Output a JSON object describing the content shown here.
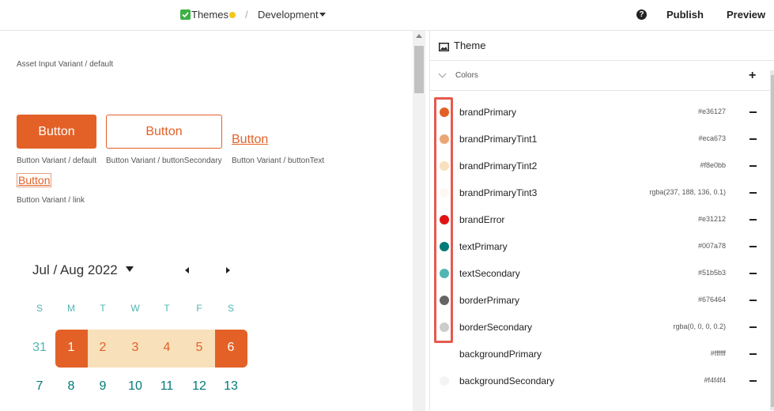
{
  "topbar": {
    "themes_label": "Themes",
    "separator": "/",
    "branch_label": "Development",
    "help_glyph": "?",
    "publish_label": "Publish",
    "preview_label": "Preview"
  },
  "canvas": {
    "asset_input_caption": "Asset Input Variant / default",
    "buttons": {
      "primary_label": "Button",
      "primary_caption": "Button Variant / default",
      "secondary_label": "Button",
      "secondary_caption": "Button Variant / buttonSecondary",
      "text_label": "Button",
      "text_caption": "Button Variant / buttonText",
      "link_label": "Button",
      "link_caption": "Button Variant / link"
    },
    "calendar": {
      "title": "Jul / Aug 2022",
      "weekdays": [
        "S",
        "M",
        "T",
        "W",
        "T",
        "F",
        "S"
      ],
      "week1": [
        "31",
        "1",
        "2",
        "3",
        "4",
        "5",
        "6"
      ],
      "week2": [
        "7",
        "8",
        "9",
        "10",
        "11",
        "12",
        "13"
      ]
    }
  },
  "panel": {
    "title": "Theme",
    "section_title": "Colors",
    "add_glyph": "+",
    "colors": [
      {
        "name": "brandPrimary",
        "value": "#e36127",
        "swatch": "#e36127"
      },
      {
        "name": "brandPrimaryTint1",
        "value": "#eca673",
        "swatch": "#eca673"
      },
      {
        "name": "brandPrimaryTint2",
        "value": "#f8e0bb",
        "swatch": "#f8e0bb"
      },
      {
        "name": "brandPrimaryTint3",
        "value": "rgba(237, 188, 136, 0.1)",
        "swatch": "rgba(237, 188, 136, 0.1)"
      },
      {
        "name": "brandError",
        "value": "#e31212",
        "swatch": "#e31212"
      },
      {
        "name": "textPrimary",
        "value": "#007a78",
        "swatch": "#007a78"
      },
      {
        "name": "textSecondary",
        "value": "#51b5b3",
        "swatch": "#51b5b3"
      },
      {
        "name": "borderPrimary",
        "value": "#676464",
        "swatch": "#676464"
      },
      {
        "name": "borderSecondary",
        "value": "rgba(0, 0, 0, 0.2)",
        "swatch": "rgba(0, 0, 0, 0.2)"
      },
      {
        "name": "backgroundPrimary",
        "value": "#ffffff",
        "swatch": "#ffffff"
      },
      {
        "name": "backgroundSecondary",
        "value": "#f4f4f4",
        "swatch": "#f4f4f4"
      }
    ]
  },
  "colors": {
    "accent": "#e36127",
    "range_fill": "#f8e0bb",
    "teal_text": "#007a78",
    "teal_light": "#51b5b3",
    "highlight": "#e55a4f"
  }
}
